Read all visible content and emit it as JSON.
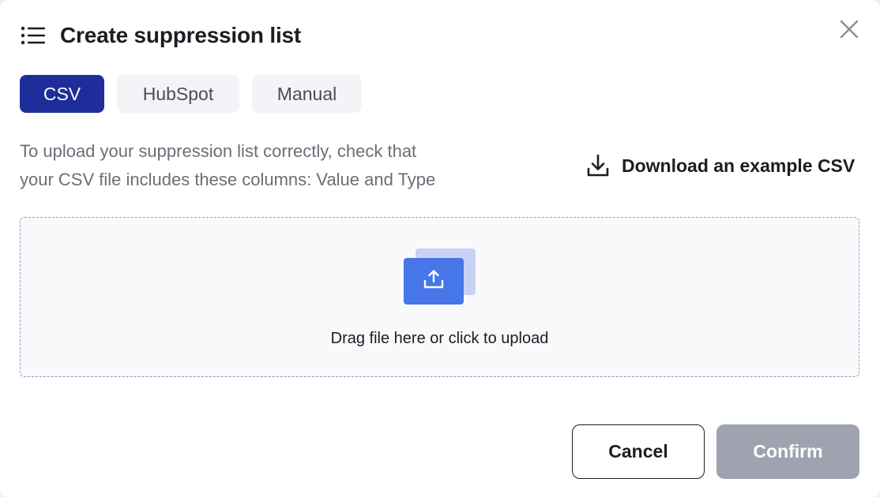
{
  "dialog": {
    "title": "Create suppression list",
    "close_label": "close"
  },
  "tabs": [
    {
      "label": "CSV",
      "active": true
    },
    {
      "label": "HubSpot",
      "active": false
    },
    {
      "label": "Manual",
      "active": false
    }
  ],
  "instructions": {
    "line1": "To upload your suppression list correctly, check that",
    "line2": "your CSV file includes these columns: Value and Type"
  },
  "download": {
    "label": "Download an example CSV",
    "icon": "download-icon"
  },
  "dropzone": {
    "label": "Drag file here or click to upload",
    "icon": "upload-icon"
  },
  "footer": {
    "cancel_label": "Cancel",
    "confirm_label": "Confirm"
  },
  "colors": {
    "primary": "#1e2d9a",
    "upload_accent": "#4676e8",
    "disabled": "#9ea3af"
  }
}
